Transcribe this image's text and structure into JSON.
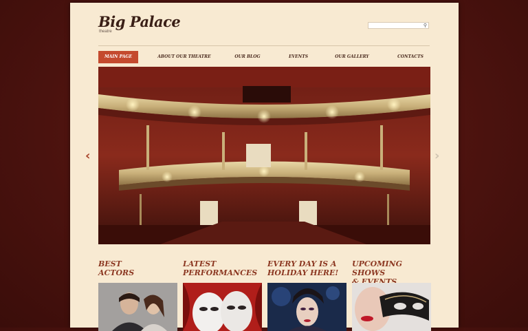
{
  "brand": {
    "title": "Big Palace",
    "subtitle": "theatre"
  },
  "search": {
    "placeholder": "",
    "icon": "search-icon"
  },
  "nav": {
    "items": [
      {
        "label": "MAIN PAGE",
        "active": true
      },
      {
        "label": "ABOUT OUR THEATRE",
        "active": false
      },
      {
        "label": "OUR BLOG",
        "active": false
      },
      {
        "label": "EVENTS",
        "active": false
      },
      {
        "label": "OUR GALLERY",
        "active": false
      },
      {
        "label": "CONTACTS",
        "active": false
      }
    ]
  },
  "slider": {
    "prev_icon": "chevron-left-icon",
    "next_icon": "chevron-right-icon"
  },
  "features": [
    {
      "line1": "BEST",
      "line2": "ACTORS"
    },
    {
      "line1": "LATEST",
      "line2": "PERFORMANCES"
    },
    {
      "line1": "EVERY DAY IS A",
      "line2": "HOLIDAY HERE!"
    },
    {
      "line1": "UPCOMING SHOWS",
      "line2": "& EVENTS"
    }
  ],
  "colors": {
    "accent": "#c44a2e",
    "background": "#4e1410",
    "page": "#f8ead2",
    "heading": "#8c3822"
  }
}
